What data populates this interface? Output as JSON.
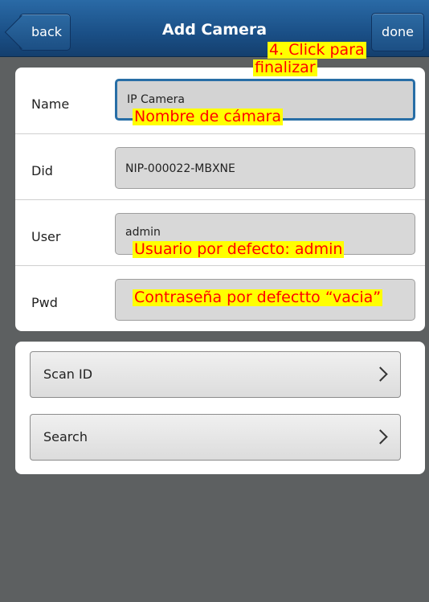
{
  "navbar": {
    "title": "Add Camera",
    "back_label": "back",
    "done_label": "done"
  },
  "form": {
    "name": {
      "label": "Name",
      "value": "IP Camera"
    },
    "did": {
      "label": "Did",
      "value": "NIP-000022-MBXNE"
    },
    "user": {
      "label": "User",
      "value": "admin"
    },
    "pwd": {
      "label": "Pwd",
      "value": ""
    }
  },
  "actions": {
    "scan_label": "Scan ID",
    "search_label": "Search"
  },
  "annotations": {
    "click_line1": "4. Click para",
    "click_line2": "finalizar",
    "name_note": "Nombre de cámara",
    "user_note": "Usuario por defecto:  admin",
    "pwd_note": "Contraseña por defectto “vacia”"
  },
  "colors": {
    "navbar": "#1a4f86",
    "background": "#5d6061",
    "active_border": "#286ea6",
    "note_bg": "#ffff00",
    "note_text": "#ff0000"
  },
  "icons": {
    "chevron": "chevron-right-icon"
  }
}
